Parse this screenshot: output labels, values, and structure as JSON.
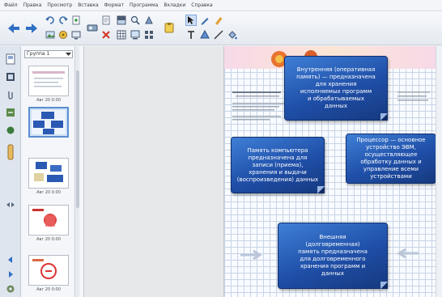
{
  "menubar": {
    "items": [
      "Файл",
      "Правка",
      "Просмотр",
      "Вставка",
      "Формат",
      "Программа",
      "Вкладки",
      "Справка"
    ]
  },
  "toolbar": {
    "icons": [
      "back-arrow-icon",
      "forward-arrow-icon",
      "undo-icon",
      "redo-icon",
      "page-add-icon",
      "delete-icon",
      "screen-icon",
      "table-icon",
      "clipboard-icon",
      "select-icon",
      "pen-icon",
      "eraser-icon",
      "shape-icon",
      "text-icon",
      "line-icon",
      "fill-icon"
    ]
  },
  "sorter": {
    "dropdown_value": "Группа 1",
    "thumb_labels": [
      "Авг 20 0:00",
      "",
      "Авг 20 0:00",
      "Авг 20 0:00",
      "Авг 20 0:00"
    ]
  },
  "slide": {
    "boxes": [
      {
        "text": "Внутренняя (оперативная\nпамять) — предназначена\nдля хранения\nисполняемых программ\nи обрабатываемых\nданных"
      },
      {
        "text": "Память компьютера\nпредназначена для\nзаписи (приема),\nхранения и выдачи\n(воспроизведения) данных"
      },
      {
        "text": "Процессор — основное\nустройство ЭВМ,\nосуществляющее\nобработку данных и\nуправление всеми\nустройствами"
      },
      {
        "text": "Внешняя\n(долговременная)\nпамять предназначена\nдля долговременного\nхранения программ и\nданных"
      }
    ]
  }
}
